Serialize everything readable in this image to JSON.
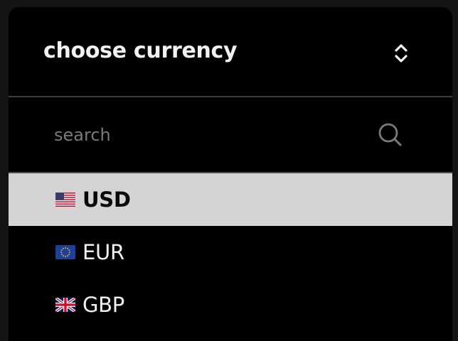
{
  "dropdown": {
    "title": "choose currency",
    "toggle_icon": "chevron-up-down-icon",
    "search": {
      "placeholder": "search",
      "value": "",
      "icon": "search-icon"
    },
    "options": [
      {
        "code": "USD",
        "flag": "us-flag-icon",
        "selected": true
      },
      {
        "code": "EUR",
        "flag": "eu-flag-icon",
        "selected": false
      },
      {
        "code": "GBP",
        "flag": "gb-flag-icon",
        "selected": false
      }
    ]
  },
  "colors": {
    "background": "#000000",
    "selected_row": "#d4d4d4",
    "text": "#f2f2f2",
    "placeholder": "#7a7a7a",
    "divider": "#505050"
  }
}
